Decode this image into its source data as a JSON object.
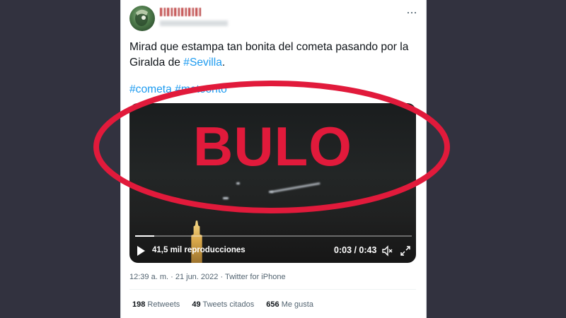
{
  "tweet": {
    "text_prefix": "Mirad que estampa tan bonita del cometa pasando por la Giralda de ",
    "text_hashtag": "#Sevilla",
    "text_suffix": ".",
    "tags": [
      "#cometa",
      "#meteorito"
    ],
    "more_icon": "more-dots-icon"
  },
  "video": {
    "progress": 0.07,
    "views_label": "41,5 mil reproducciones",
    "time_label": "0:03 / 0:43"
  },
  "overlay": {
    "label": "BULO",
    "color": "#e11a3b"
  },
  "meta": {
    "time": "12:39 a. m.",
    "separator1": " · ",
    "date": "21 jun. 2022",
    "separator2": " · ",
    "source": "Twitter for iPhone"
  },
  "stats": {
    "retweets_count": "198",
    "retweets_label": "Retweets",
    "quotes_count": "49",
    "quotes_label": "Tweets citados",
    "likes_count": "656",
    "likes_label": "Me gusta"
  },
  "colors": {
    "background": "#32323f",
    "link": "#1d9bf0",
    "text": "#0f1419",
    "muted": "#536471"
  }
}
